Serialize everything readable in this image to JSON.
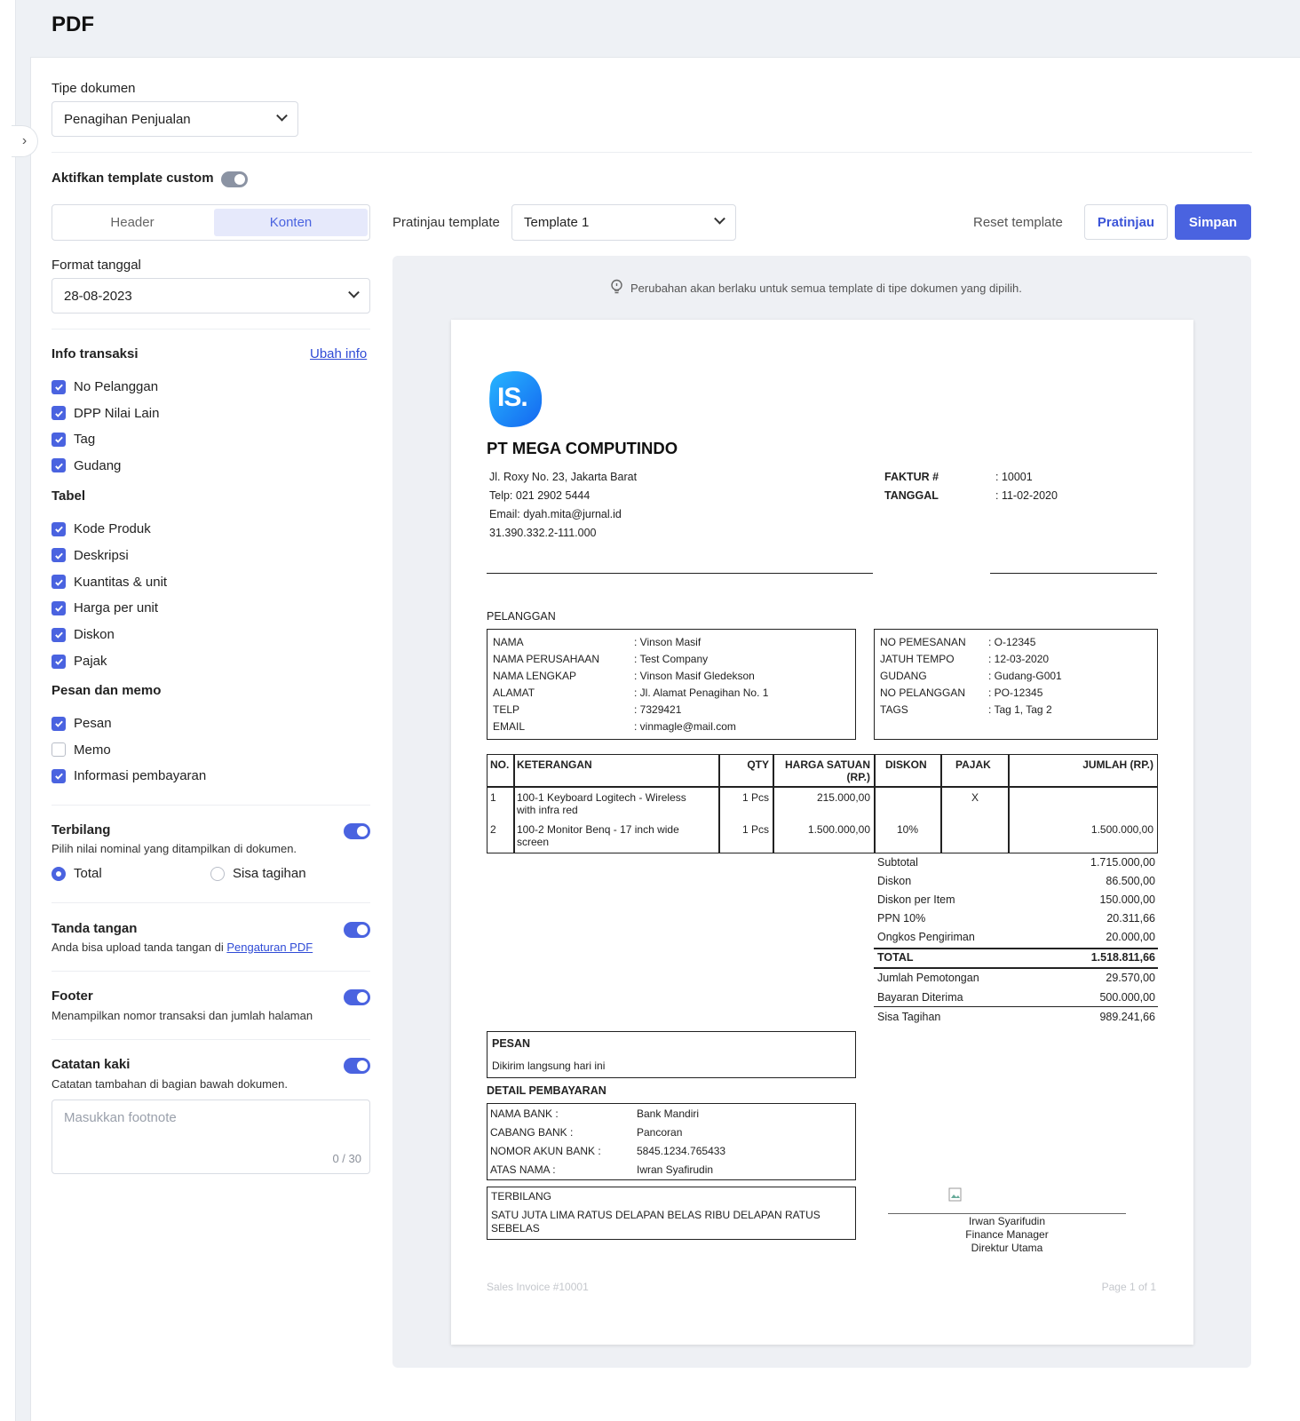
{
  "page_title": "PDF",
  "doc_type": {
    "label": "Tipe dokumen",
    "value": "Penagihan Penjualan"
  },
  "custom_template": {
    "label": "Aktifkan template custom"
  },
  "tabs": {
    "header": "Header",
    "konten": "Konten"
  },
  "date_format": {
    "label": "Format tanggal",
    "value": "28-08-2023"
  },
  "info_transaksi": {
    "label": "Info transaksi",
    "link": "Ubah info",
    "items": [
      {
        "label": "No Pelanggan",
        "checked": true
      },
      {
        "label": "DPP Nilai Lain",
        "checked": true
      },
      {
        "label": "Tag",
        "checked": true
      },
      {
        "label": "Gudang",
        "checked": true
      }
    ]
  },
  "tabel": {
    "label": "Tabel",
    "items": [
      {
        "label": "Kode Produk",
        "checked": true
      },
      {
        "label": "Deskripsi",
        "checked": true
      },
      {
        "label": "Kuantitas & unit",
        "checked": true
      },
      {
        "label": "Harga per unit",
        "checked": true
      },
      {
        "label": "Diskon",
        "checked": true
      },
      {
        "label": "Pajak",
        "checked": true
      }
    ]
  },
  "pesan_memo": {
    "label": "Pesan dan memo",
    "items": [
      {
        "label": "Pesan",
        "checked": true
      },
      {
        "label": "Memo",
        "checked": false
      },
      {
        "label": "Informasi pembayaran",
        "checked": true
      }
    ]
  },
  "terbilang": {
    "title": "Terbilang",
    "desc": "Pilih nilai nominal yang ditampilkan di dokumen.",
    "opt1": "Total",
    "opt2": "Sisa tagihan"
  },
  "tanda_tangan": {
    "title": "Tanda tangan",
    "desc": "Anda bisa upload tanda tangan di",
    "link": "Pengaturan PDF"
  },
  "footer": {
    "title": "Footer",
    "desc": "Menampilkan nomor transaksi dan jumlah halaman"
  },
  "catatan": {
    "title": "Catatan kaki",
    "desc": "Catatan tambahan di bagian bawah dokumen.",
    "placeholder": "Masukkan footnote",
    "counter": "0 / 30"
  },
  "toolbar": {
    "preview_label": "Pratinjau template",
    "template": "Template 1",
    "reset": "Reset template",
    "pratinjau": "Pratinjau",
    "simpan": "Simpan"
  },
  "notice": "Perubahan akan berlaku untuk semua template di tipe dokumen yang dipilih.",
  "colors": {
    "accent": "#4a63e0",
    "link": "#2f4bd6",
    "logo": "#1e90ff"
  },
  "invoice": {
    "logo_text": "IS.",
    "company": "PT MEGA COMPUTINDO",
    "address": [
      "Jl. Roxy No. 23, Jakarta Barat",
      "Telp: 021 2902 5444",
      "Email: dyah.mita@jurnal.id",
      "31.390.332.2-111.000"
    ],
    "faktur_label": "FAKTUR #",
    "faktur": ": 10001",
    "tanggal_label": "TANGGAL",
    "tanggal": ": 11-02-2020",
    "pelanggan": "PELANGGAN",
    "cust_labels": [
      "NAMA",
      "NAMA PERUSAHAAN",
      "NAMA LENGKAP",
      "ALAMAT",
      "TELP",
      "EMAIL"
    ],
    "cust_values": [
      ": Vinson Masif",
      ": Test Company",
      ": Vinson Masif Gledekson",
      ": Jl. Alamat Penagihan No. 1",
      ": 7329421",
      ": vinmagle@mail.com"
    ],
    "order_labels": [
      "NO PEMESANAN",
      "JATUH TEMPO",
      "GUDANG",
      "NO PELANGGAN",
      "TAGS"
    ],
    "order_values": [
      ": O-12345",
      ": 12-03-2020",
      ": Gudang-G001",
      ": PO-12345",
      ": Tag 1, Tag 2"
    ],
    "th": {
      "no": "NO.",
      "ket": "KETERANGAN",
      "qty": "QTY",
      "harga1": "HARGA SATUAN",
      "harga2": "(RP.)",
      "diskon": "DISKON",
      "pajak": "PAJAK",
      "jumlah": "JUMLAH (RP.)"
    },
    "rows": [
      {
        "no": "1",
        "ket1": "100-1 Keyboard Logitech - Wireless",
        "ket2": "with infra red",
        "qty": "1 Pcs",
        "harga": "215.000,00",
        "diskon": "",
        "pajak": "X",
        "jumlah": ""
      },
      {
        "no": "2",
        "ket1": "100-2 Monitor Benq - 17 inch wide",
        "ket2": "screen",
        "qty": "1 Pcs",
        "harga": "1.500.000,00",
        "diskon": "10%",
        "pajak": "",
        "jumlah": "1.500.000,00"
      }
    ],
    "totals": [
      {
        "l": "Subtotal",
        "v": "1.715.000,00"
      },
      {
        "l": "Diskon",
        "v": "86.500,00"
      },
      {
        "l": "Diskon per Item",
        "v": "150.000,00"
      },
      {
        "l": "PPN 10%",
        "v": "20.311,66"
      },
      {
        "l": "Ongkos Pengiriman",
        "v": "20.000,00"
      }
    ],
    "total": {
      "l": "TOTAL",
      "v": "1.518.811,66"
    },
    "after": [
      {
        "l": "Jumlah Pemotongan",
        "v": "29.570,00"
      },
      {
        "l": "Bayaran Diterima",
        "v": "500.000,00"
      },
      {
        "l": "Sisa Tagihan",
        "v": "989.241,66"
      }
    ],
    "pesan_title": "PESAN",
    "pesan": "Dikirim langsung hari ini",
    "detail_title": "DETAIL PEMBAYARAN",
    "bank_labels": [
      "NAMA BANK :",
      "CABANG BANK :",
      "NOMOR AKUN BANK :",
      "ATAS NAMA :"
    ],
    "bank_values": [
      "Bank Mandiri",
      "Pancoran",
      "5845.1234.765433",
      "Iwran Syafirudin"
    ],
    "terbilang_title": "TERBILANG",
    "terbilang1": "SATU JUTA LIMA RATUS DELAPAN BELAS RIBU DELAPAN RATUS",
    "terbilang2": "SEBELAS",
    "sig": [
      "Irwan Syarifudin",
      "Finance Manager",
      "Direktur Utama"
    ],
    "foot_left": "Sales Invoice #10001",
    "foot_right": "Page 1 of 1"
  }
}
